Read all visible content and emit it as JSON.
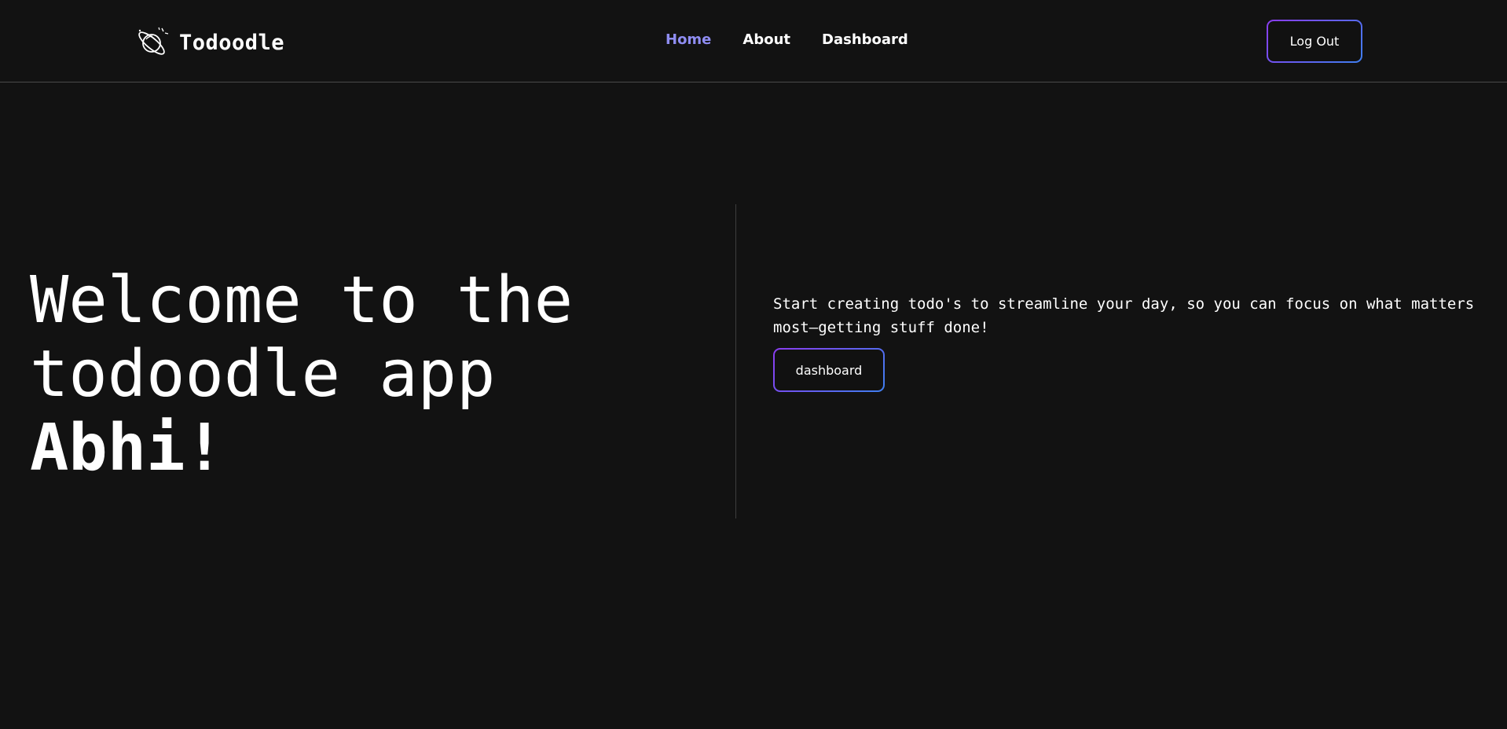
{
  "brand": {
    "name": "Todoodle",
    "logo_icon": "planet-doodle-icon"
  },
  "nav": {
    "items": [
      {
        "label": "Home",
        "active": true
      },
      {
        "label": "About",
        "active": false
      },
      {
        "label": "Dashboard",
        "active": false
      }
    ],
    "logout_label": "Log Out"
  },
  "hero": {
    "title_line1": "Welcome to the",
    "title_line2": "todoodle app",
    "user_name": "Abhi!",
    "description": "Start creating todo's to streamline your day, so you can focus on what matters most—getting stuff done!",
    "cta_label": "dashboard"
  },
  "colors": {
    "background": "#121212",
    "active_link": "#8f8df2",
    "gradient_start": "#8b3cf0",
    "gradient_end": "#3f7ff0"
  }
}
